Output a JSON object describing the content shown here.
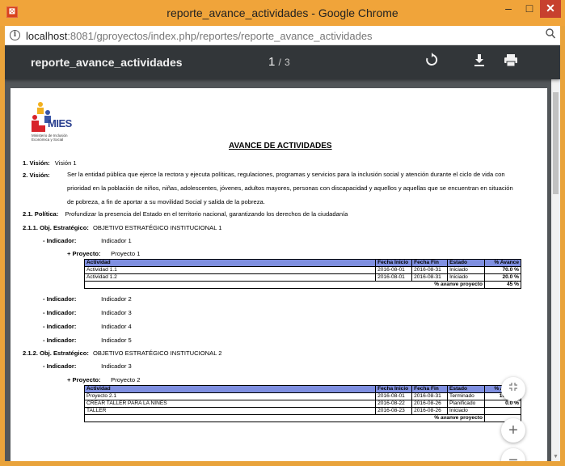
{
  "window": {
    "title": "reporte_avance_actividades - Google Chrome",
    "minimize": "–",
    "maximize": "□",
    "close": "✕"
  },
  "address": {
    "host": "localhost",
    "rest": ":8081/gproyectos/index.php/reportes/reporte_avance_actividades"
  },
  "viewer": {
    "title": "reporte_avance_actividades",
    "page_current": "1",
    "page_sep": "/",
    "page_total": "3"
  },
  "report": {
    "logo_text": "MIES",
    "logo_sub": "Ministerio de Inclusión Económica y Social",
    "title": "AVANCE DE ACTIVIDADES",
    "vision1_label": "1. Visión:",
    "vision1_value": "Visión 1",
    "vision2_label": "2. Visión:",
    "vision2_text": "Ser la entidad pública que ejerce la rectora y ejecuta políticas, regulaciones, programas y servicios para la inclusión social y atención durante el  ciclo de vida con prioridad en la población de niños, niñas, adolescentes, jóvenes, adultos mayores, personas con discapacidad y aquellos y aquellas que se encuentran en situación de pobreza, a fin de aportar a su movilidad Social y salida de la pobreza.",
    "politica_label": "2.1. Política:",
    "politica_value": "Profundizar la presencia del Estado en el territorio nacional, garantizando los derechos de la ciudadanía",
    "obj1_label": "2.1.1. Obj. Estratégico:",
    "obj1_value": "OBJETIVO ESTRATÉGICO INSTITUCIONAL 1",
    "obj2_label": "2.1.2. Obj. Estratégico:",
    "obj2_value": "OBJETIVO ESTRATÉGICO INSTITUCIONAL 2",
    "indicador_label": "- Indicador:",
    "proyecto_label": "+ Proyecto:",
    "ind1": "Indicador 1",
    "ind2": "Indicador 2",
    "ind3": "Indicador 3",
    "ind4": "Indicador 4",
    "ind5": "Indicador 5",
    "ind3b": "Indicador 3",
    "proy1": "Proyecto 1",
    "proy2": "Proyecto 2",
    "headers": [
      "Actividad",
      "Fecha Inicio",
      "Fecha Fin",
      "Estado",
      "% Avance"
    ],
    "table1": {
      "rows": [
        [
          "Actividad 1.1",
          "2016-08-01",
          "2016-08-31",
          "Iniciado",
          "70.0 %"
        ],
        [
          "Actividad 1.2",
          "2016-08-01",
          "2016-08-31",
          "Iniciado",
          "20.0 %"
        ]
      ],
      "footer_label": "% avanve proyecto",
      "footer_value": "45 %"
    },
    "table2": {
      "rows": [
        [
          "Proyecto 2.1",
          "2016-08-01",
          "2016-08-31",
          "Terminado",
          "100.0 %"
        ],
        [
          "CREAR TALLER PARA LA NIÑES",
          "2016-08-22",
          "2016-08-26",
          "Planificado",
          "0.0 %"
        ],
        [
          "TALLER",
          "2016-08-23",
          "2016-08-26",
          "Iniciado",
          ""
        ]
      ],
      "footer_label": "% avanve proyecto",
      "footer_value": ""
    }
  },
  "icons": {
    "rotate": "rotate-icon",
    "download": "download-icon",
    "print": "print-icon",
    "fit": "fit-page-icon",
    "zoom_in": "plus-icon",
    "zoom_out": "minus-icon"
  }
}
